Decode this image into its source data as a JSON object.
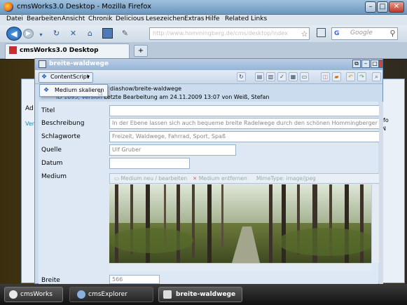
{
  "browser": {
    "window_title": "cmsWorks3.0 Desktop - Mozilla Firefox",
    "menu": [
      "Datei",
      "Bearbeiten",
      "Ansicht",
      "Chronik",
      "Delicious",
      "Lesezeichen",
      "Extras",
      "Hilfe",
      "Related Links"
    ],
    "url": "http://www.hommingberg.de/cms/desktop/index",
    "search_engine": "Google",
    "search_placeholder": "Google",
    "tab_title": "cmsWorks3.0 Desktop",
    "new_tab": "+"
  },
  "background_window": {
    "ad_label": "Ad",
    "ver_label": "Ver",
    "right_label_1": "fo",
    "right_label_2": "N"
  },
  "dialog": {
    "title": "breite-waldwege",
    "toolbar": {
      "content_script_label": "ContentScript",
      "menu_item": "Medium skalieren"
    },
    "path": "diashow/breite-waldwege",
    "version_prefix": "ID 1695, Version",
    "last_edit": "Letzte Bearbeitung am 24.11.2009 13:07 von Weiß, Stefan",
    "fields": {
      "titel_label": "Titel",
      "titel_value": "",
      "beschreibung_label": "Beschreibung",
      "beschreibung_value": "In der Ebene lassen sich auch bequeme breite Radelwege durch den schönen Hommingberger Wald",
      "schlagworte_label": "Schlagworte",
      "schlagworte_value": "Freizeit, Waldwege, Fahrrad, Sport, Spaß",
      "quelle_label": "Quelle",
      "quelle_value": "Ulf Gruber",
      "datum_label": "Datum",
      "datum_value": "",
      "medium_label": "Medium",
      "breite_label": "Breite",
      "breite_value": "566"
    },
    "medium_toolbar": {
      "new_edit": "Medium neu / bearbeiten",
      "remove": "Medium entfernen",
      "mimetype": "MimeType: image/jpeg"
    }
  },
  "taskbar": {
    "start": "cmsWorks",
    "tasks": [
      "cmsExplorer",
      "breite-waldwege"
    ]
  },
  "colors": {
    "dialog_header": "#97b5d8",
    "taskbar": "#1a1a1a",
    "accent": "#1e5cb3"
  }
}
